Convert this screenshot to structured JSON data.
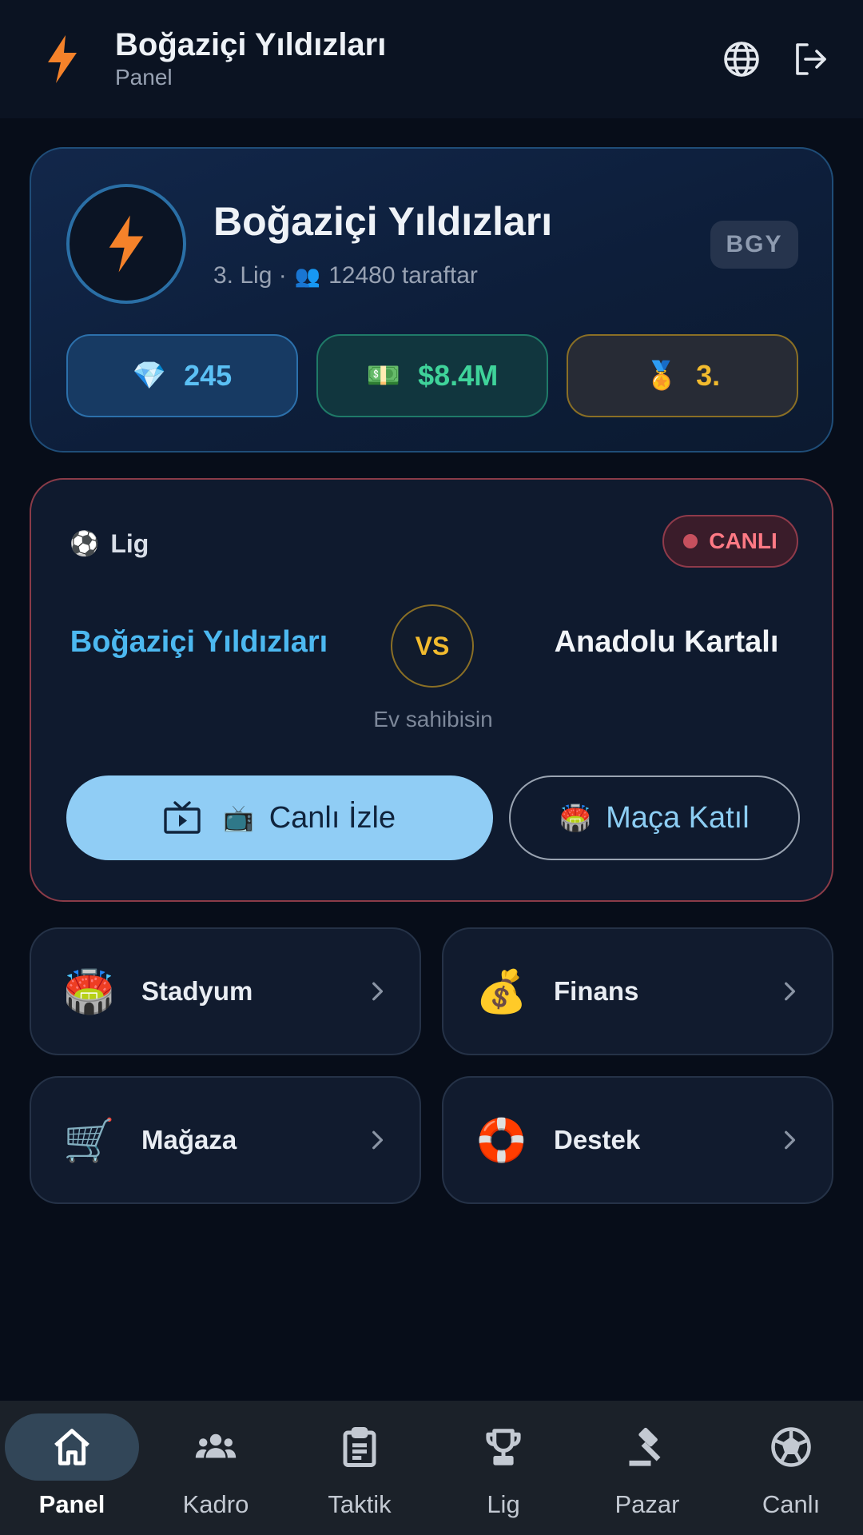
{
  "header": {
    "title": "Boğaziçi Yıldızları",
    "subtitle": "Panel",
    "icons": [
      "bolt-icon",
      "globe-icon",
      "logout-icon"
    ]
  },
  "team": {
    "name": "Boğaziçi Yıldızları",
    "league": "3. Lig ·",
    "fans_icon": "👥",
    "fans": "12480 taraftar",
    "abbr": "BGY",
    "stats": {
      "gems_icon": "💎",
      "gems": "245",
      "money_icon": "💵",
      "money": "$8.4M",
      "rank_icon": "🏅",
      "rank": "3."
    }
  },
  "match": {
    "league_icon": "⚽",
    "league": "Lig",
    "status": "CANLI",
    "home": "Boğaziçi Yıldızları",
    "vs": "VS",
    "away": "Anadolu Kartalı",
    "note": "Ev sahibisin",
    "watch_icon": "📺",
    "watch_label": "Canlı İzle",
    "join_icon": "🏟️",
    "join_label": "Maça Katıl"
  },
  "tiles": [
    {
      "emoji": "🏟️",
      "label": "Stadyum"
    },
    {
      "emoji": "💰",
      "label": "Finans"
    },
    {
      "emoji": "🛒",
      "label": "Mağaza"
    },
    {
      "emoji": "🛟",
      "label": "Destek"
    }
  ],
  "nav": [
    {
      "label": "Panel",
      "icon": "home-icon",
      "active": true
    },
    {
      "label": "Kadro",
      "icon": "group-icon",
      "active": false
    },
    {
      "label": "Taktik",
      "icon": "clipboard-icon",
      "active": false
    },
    {
      "label": "Lig",
      "icon": "trophy-icon",
      "active": false
    },
    {
      "label": "Pazar",
      "icon": "gavel-icon",
      "active": false
    },
    {
      "label": "Canlı",
      "icon": "soccer-ball-icon",
      "active": false
    }
  ],
  "colors": {
    "background": "#070d19",
    "accent": "#4cb8f0",
    "live": "#ff7a85",
    "gold": "#f2bb2e",
    "money": "#3fd39a",
    "bolt": "#f5822a"
  }
}
